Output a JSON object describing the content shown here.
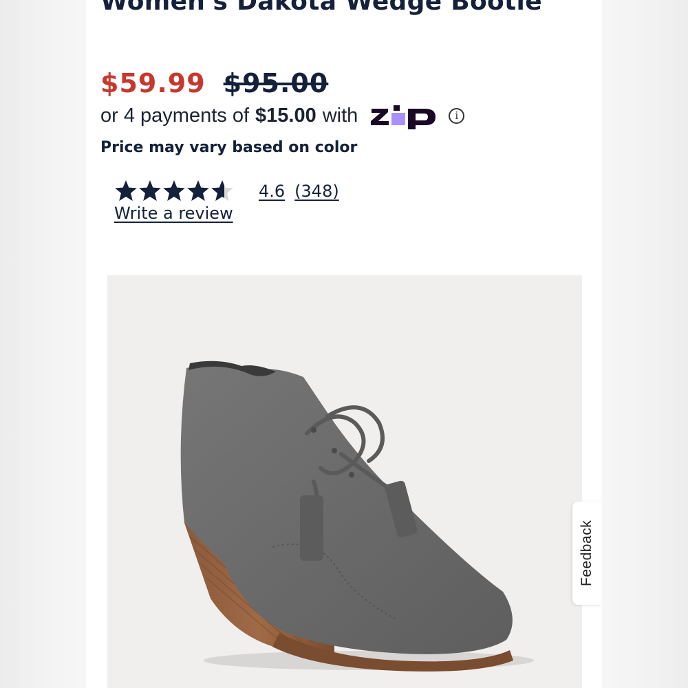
{
  "product": {
    "title": "Women's Dakota Wedge Bootie",
    "sale_price": "$59.99",
    "original_price": "$95.00"
  },
  "installments": {
    "prefix": "or 4 payments of",
    "amount": "$15.00",
    "suffix": "with",
    "provider_logo": "zip-logo",
    "info_icon": "info-icon",
    "info_glyph": "i"
  },
  "price_note": "Price may vary based on color",
  "rating": {
    "stars_value": 4.6,
    "stars_max": 5,
    "score": "4.6",
    "count": "(348)",
    "write_review": "Write a review"
  },
  "product_image": {
    "subject": "grey suede lace-up wedge bootie"
  },
  "feedback": {
    "label": "Feedback"
  },
  "colors": {
    "title": "#15213a",
    "sale_price": "#c8372d",
    "zip_purple": "#aa8fff",
    "zip_dark": "#1a0826",
    "star": "#15213a",
    "image_bg": "#f0efee"
  }
}
